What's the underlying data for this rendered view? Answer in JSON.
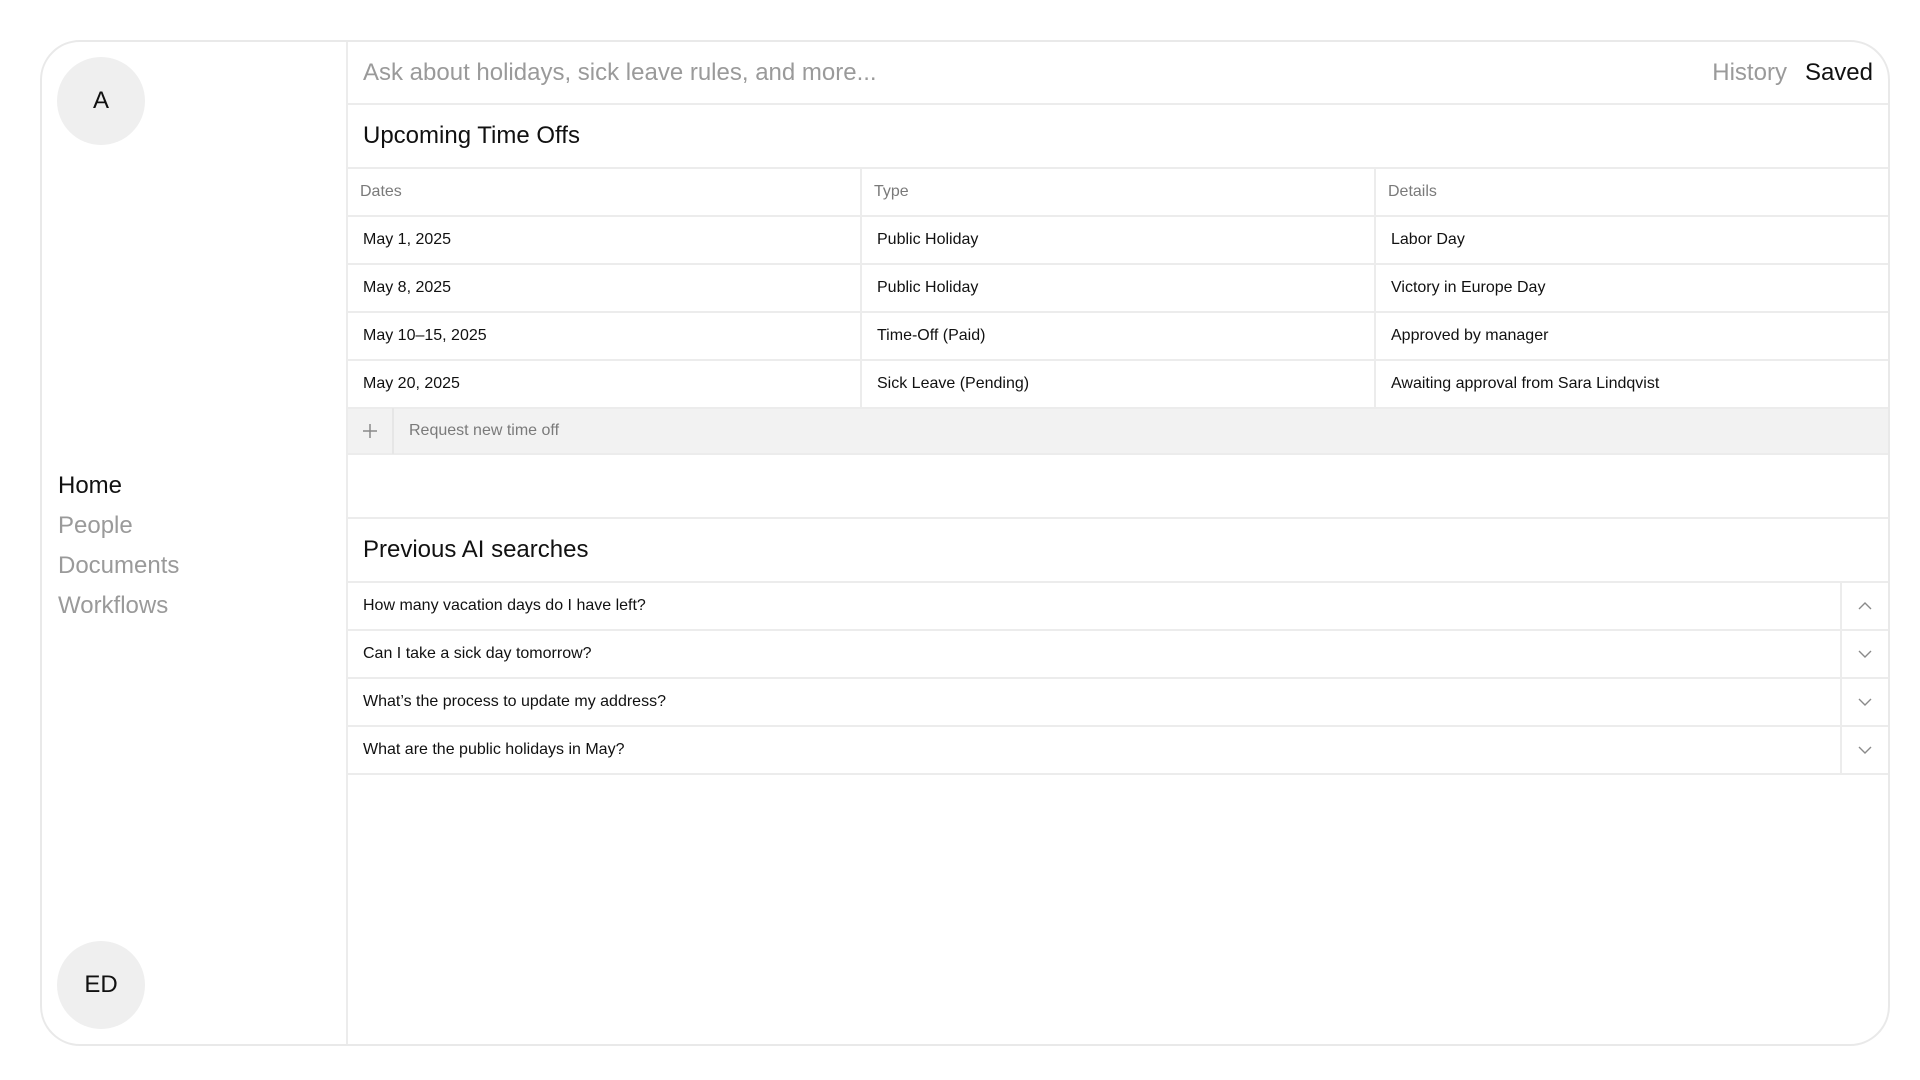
{
  "sidebar": {
    "user_initial": "A",
    "nav": [
      {
        "label": "Home",
        "active": true
      },
      {
        "label": "People",
        "active": false
      },
      {
        "label": "Documents",
        "active": false
      },
      {
        "label": "Workflows",
        "active": false
      }
    ],
    "profile_initials": "ED"
  },
  "header": {
    "search_placeholder": "Ask about holidays, sick leave rules, and more...",
    "tabs": [
      {
        "label": "History",
        "active": false
      },
      {
        "label": "Saved",
        "active": true
      }
    ]
  },
  "timeoffs": {
    "title": "Upcoming Time Offs",
    "columns": [
      "Dates",
      "Type",
      "Details"
    ],
    "rows": [
      [
        "May 1, 2025",
        "Public Holiday",
        "Labor Day"
      ],
      [
        "May 8, 2025",
        "Public Holiday",
        "Victory in Europe Day"
      ],
      [
        "May 10–15, 2025",
        "Time-Off (Paid)",
        "Approved by manager"
      ],
      [
        "May 20, 2025",
        "Sick Leave (Pending)",
        "Awaiting approval from Sara Lindqvist"
      ]
    ],
    "add_label": "Request new time off"
  },
  "searches": {
    "title": "Previous AI searches",
    "items": [
      {
        "question": "How many vacation days do I have left?",
        "icon": "chevron-up-icon"
      },
      {
        "question": "Can I take a sick day tomorrow?",
        "icon": "chevron-down-icon"
      },
      {
        "question": "What’s the process to update my address?",
        "icon": "chevron-down-icon"
      },
      {
        "question": "What are the public holidays in May?",
        "icon": "chevron-down-icon"
      }
    ]
  }
}
